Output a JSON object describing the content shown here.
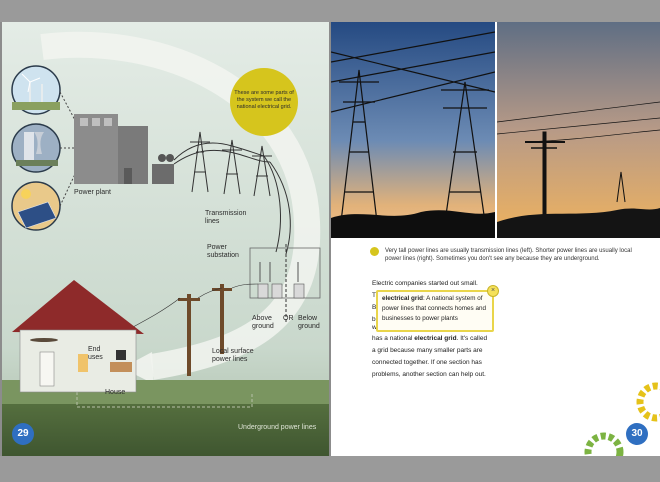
{
  "left_page": {
    "bubble_text": "These are some parts of the system we call the national electrical grid.",
    "labels": {
      "power_plant": "Power plant",
      "transmission": "Transmission lines",
      "substation": "Power substation",
      "above_ground": "Above ground",
      "or": "OR",
      "below_ground": "Below ground",
      "end_uses": "End uses",
      "local_lines": "Local surface power lines",
      "house": "House",
      "underground": "Underground power lines"
    },
    "page_number": "29"
  },
  "right_page": {
    "caption": "Very tall power lines are usually transmission lines (left). Shorter power lines are usually local power lines (right). Sometimes you don't see any because they are underground.",
    "body": {
      "line1": "Electric companies started out small.",
      "line2a": "T",
      "line2b": "B",
      "line2c": "b",
      "line2d": "w",
      "line3_pre": "has a national ",
      "line3_bold": "electrical grid",
      "line3_post": ". It's called",
      "line4": "a grid because many smaller parts are",
      "line5": "connected together. If one section has",
      "line6": "problems, another section can help out."
    },
    "tooltip": {
      "term": "electrical grid",
      "definition": ": A national system of power lines that connects homes and businesses to power plants",
      "close": "×"
    },
    "page_number": "30"
  },
  "colors": {
    "accent_blue": "#2f6fc1",
    "bubble_yellow": "#d6c51d",
    "gear_yellow": "#e5c21a",
    "gear_green": "#7cb342",
    "roof_red": "#8e2a2a"
  }
}
